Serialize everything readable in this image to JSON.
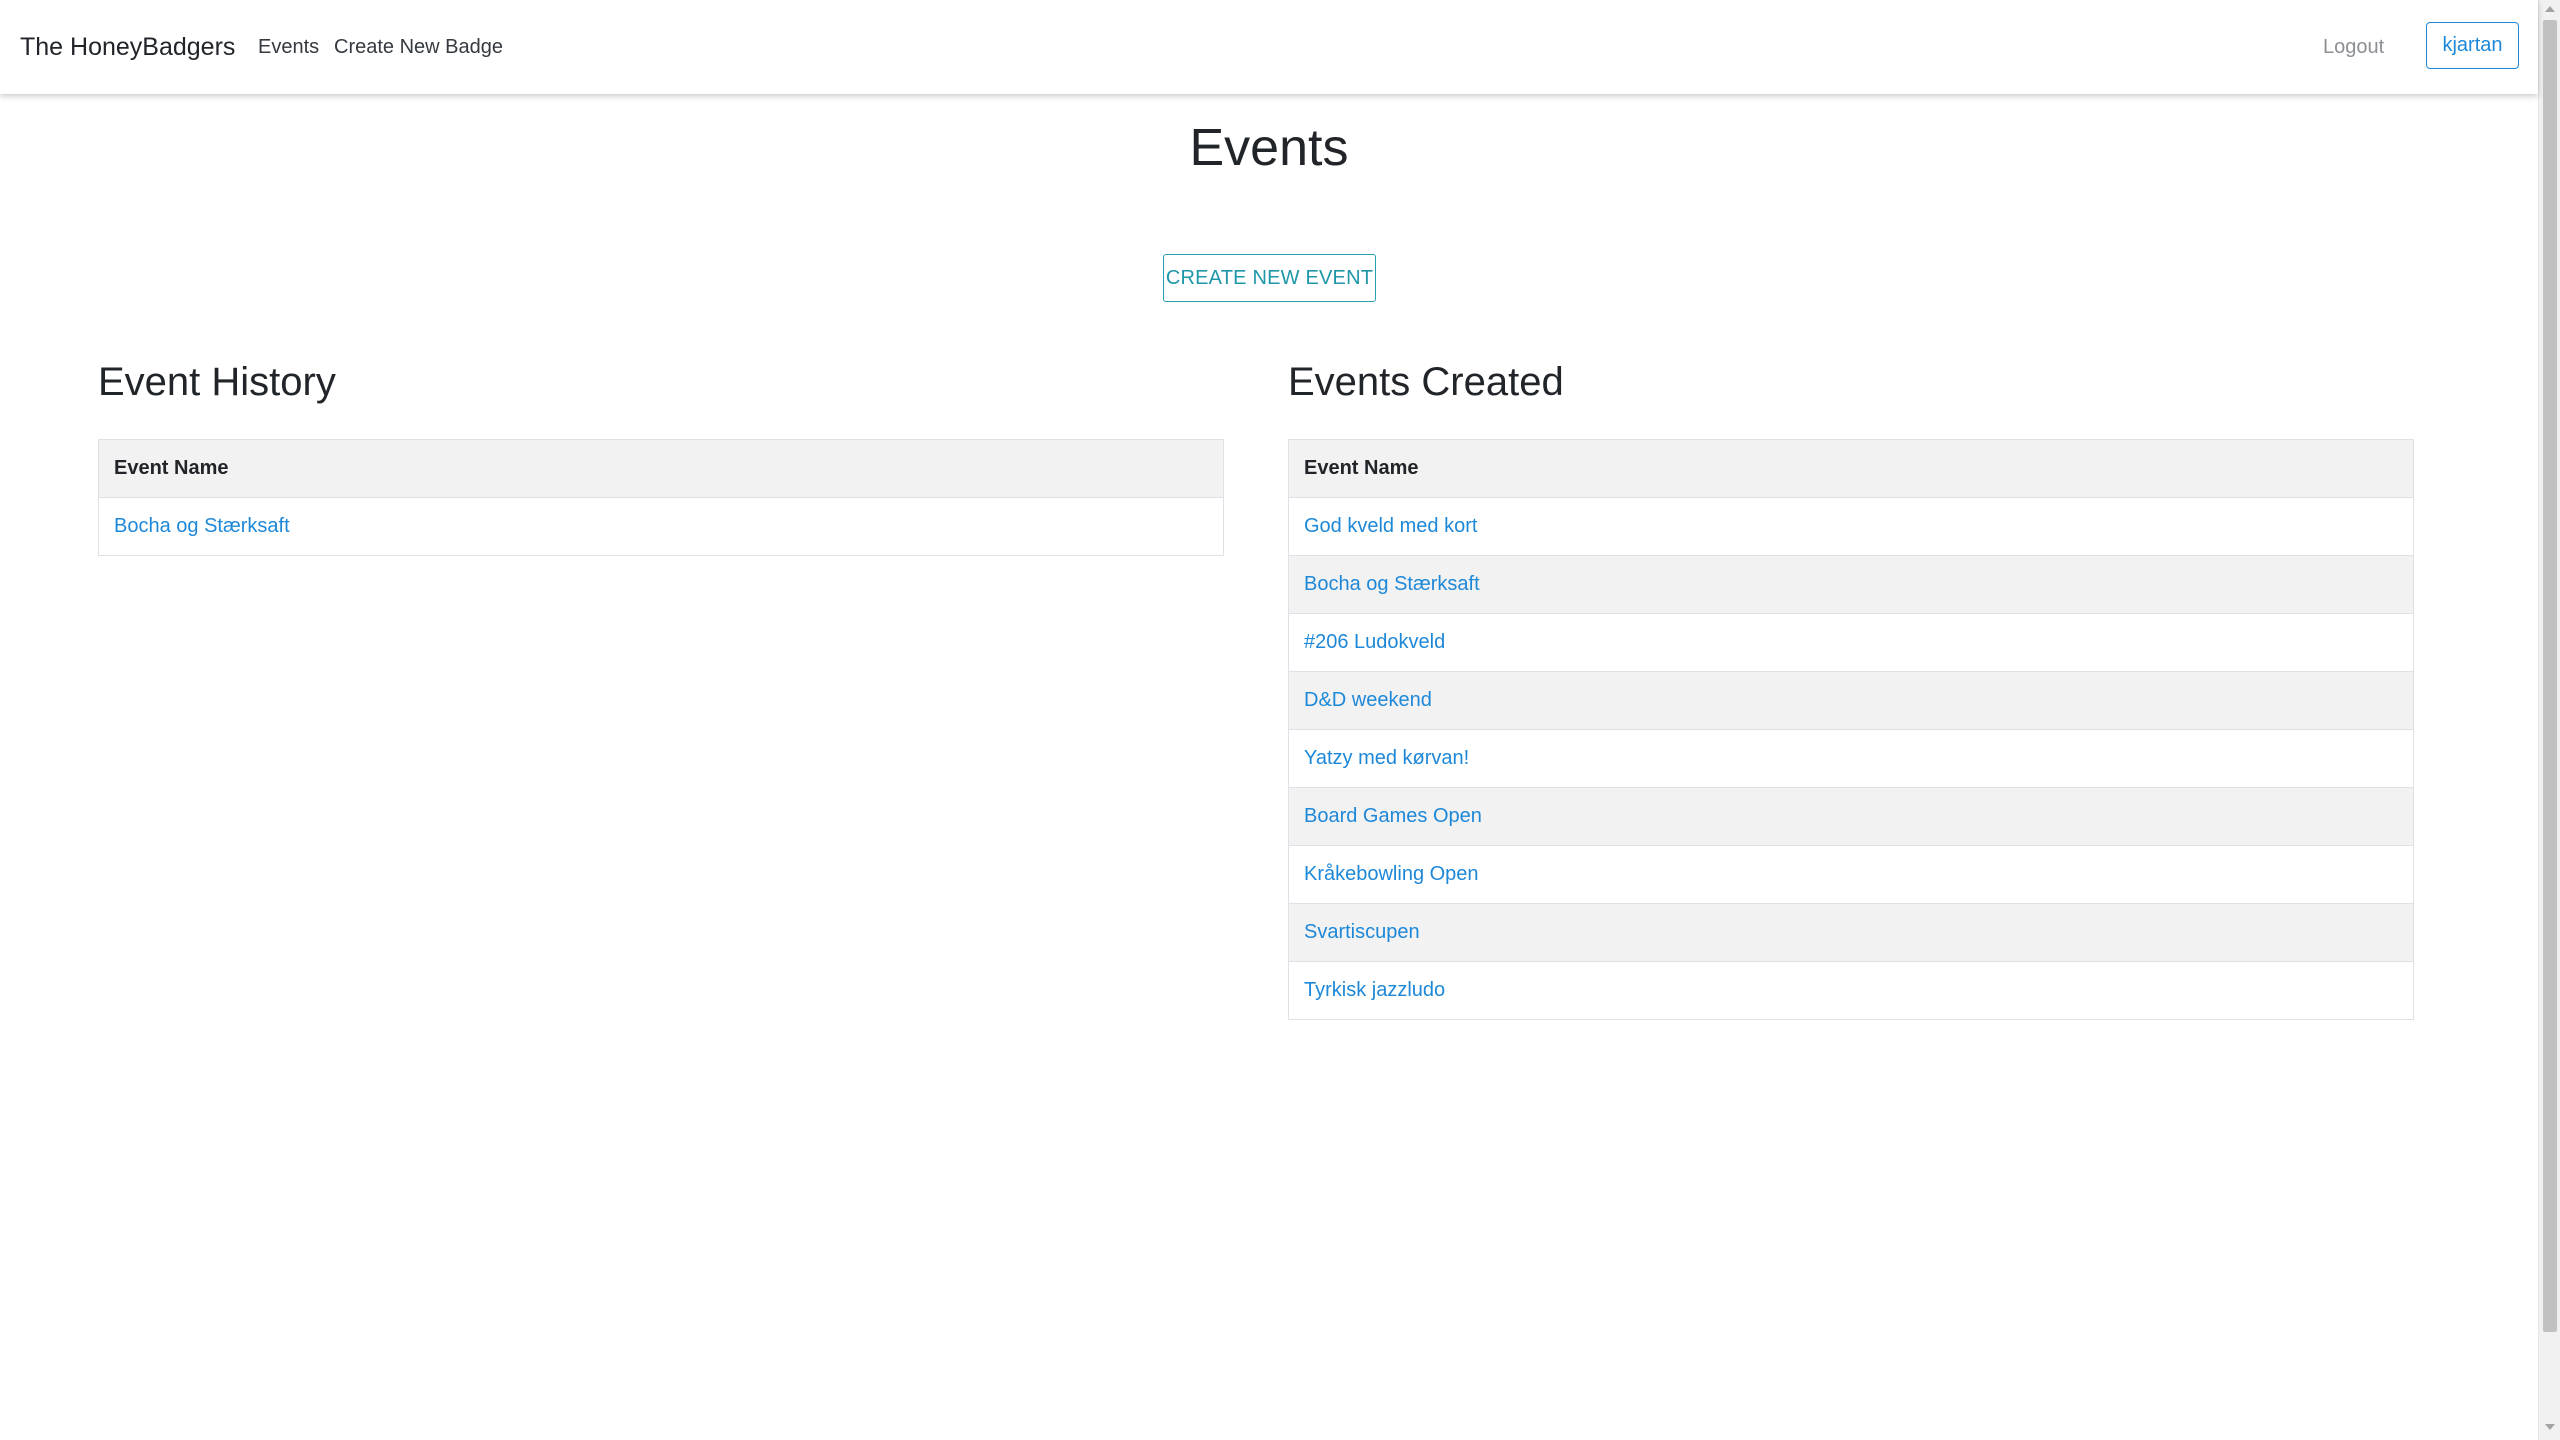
{
  "navbar": {
    "brand": "The HoneyBadgers",
    "links": [
      "Events",
      "Create New Badge"
    ],
    "logout": "Logout",
    "user": "kjartan"
  },
  "page": {
    "title": "Events",
    "create_button": "CREATE NEW EVENT"
  },
  "history": {
    "heading": "Event History",
    "column": "Event Name",
    "rows": [
      "Bocha og Stærksaft"
    ]
  },
  "created": {
    "heading": "Events Created",
    "column": "Event Name",
    "rows": [
      "God kveld med kort",
      "Bocha og Stærksaft",
      "#206 Ludokveld",
      "D&D weekend",
      "Yatzy med kørvan!",
      "Board Games Open",
      "Kråkebowling Open",
      "Svartiscupen",
      "Tyrkisk jazzludo"
    ]
  },
  "colors": {
    "link": "#1e88d8",
    "create_button": "#26a1b1",
    "header_row_bg": "#f2f2f2"
  }
}
